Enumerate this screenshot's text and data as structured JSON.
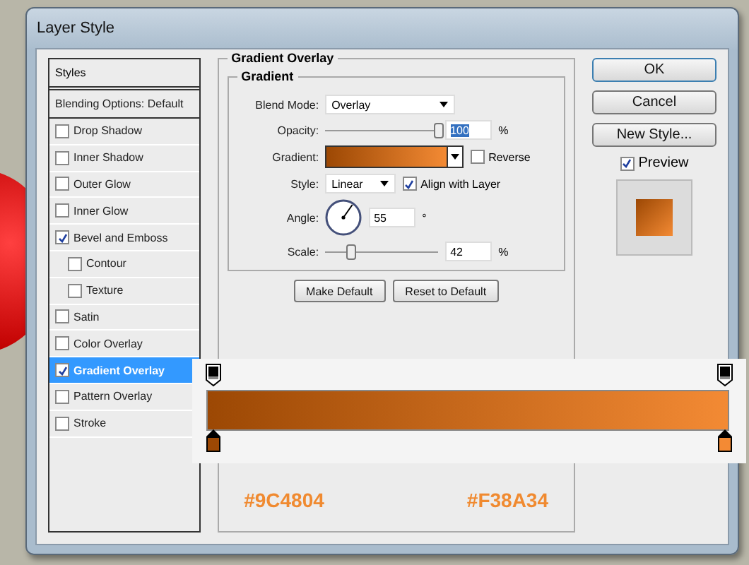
{
  "window": {
    "title": "Layer Style"
  },
  "styles_panel": {
    "header": "Styles",
    "items": [
      {
        "label": "Blending Options: Default",
        "kind": "plain",
        "selected": false
      },
      {
        "label": "Drop Shadow",
        "kind": "checkbox",
        "checked": false,
        "selected": false
      },
      {
        "label": "Inner Shadow",
        "kind": "checkbox",
        "checked": false,
        "selected": false
      },
      {
        "label": "Outer Glow",
        "kind": "checkbox",
        "checked": false,
        "selected": false
      },
      {
        "label": "Inner Glow",
        "kind": "checkbox",
        "checked": false,
        "selected": false
      },
      {
        "label": "Bevel and Emboss",
        "kind": "checkbox",
        "checked": true,
        "selected": false,
        "children": [
          {
            "label": "Contour",
            "kind": "checkbox",
            "checked": false,
            "selected": false
          },
          {
            "label": "Texture",
            "kind": "checkbox",
            "checked": false,
            "selected": false
          }
        ]
      },
      {
        "label": "Satin",
        "kind": "checkbox",
        "checked": false,
        "selected": false
      },
      {
        "label": "Color Overlay",
        "kind": "checkbox",
        "checked": false,
        "selected": false
      },
      {
        "label": "Gradient Overlay",
        "kind": "checkbox",
        "checked": true,
        "selected": true
      },
      {
        "label": "Pattern Overlay",
        "kind": "checkbox",
        "checked": false,
        "selected": false
      },
      {
        "label": "Stroke",
        "kind": "checkbox",
        "checked": false,
        "selected": false
      }
    ]
  },
  "gradient_overlay": {
    "title": "Gradient Overlay",
    "group_title": "Gradient",
    "blend_mode": {
      "label": "Blend Mode:",
      "value": "Overlay"
    },
    "opacity": {
      "label": "Opacity:",
      "level": 1,
      "value": "100",
      "unit": "%"
    },
    "gradient": {
      "label": "Gradient:"
    },
    "reverse": {
      "label": "Reverse",
      "checked": false
    },
    "style": {
      "label": "Style:",
      "value": "Linear"
    },
    "align_with_layer": {
      "label": "Align with Layer",
      "checked": true
    },
    "angle": {
      "label": "Angle:",
      "value": "55",
      "unit": "°"
    },
    "scale": {
      "label": "Scale:",
      "level": 0.23,
      "value": "42",
      "unit": "%"
    },
    "buttons": [
      "Make Default",
      "Reset to Default"
    ]
  },
  "actions": [
    "OK",
    "Cancel",
    "New Style..."
  ],
  "preview": {
    "label": "Preview",
    "checked": true
  },
  "gradient_editor": {
    "stops": [
      {
        "color": "#9c4804"
      },
      {
        "color": "#f38a34"
      }
    ],
    "labels": [
      "#9C4804",
      "#F38A34"
    ]
  }
}
